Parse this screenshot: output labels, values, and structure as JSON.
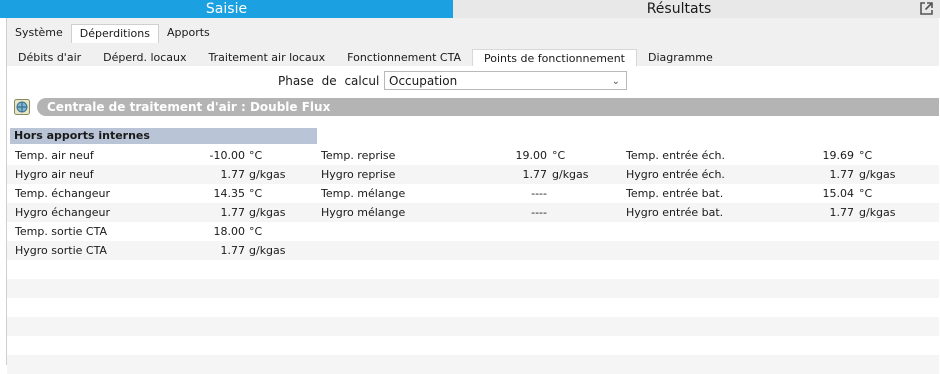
{
  "top_tabs": {
    "saisie": "Saisie",
    "resultats": "Résultats",
    "external_icon": "external-link-icon"
  },
  "tabs1": [
    "Système",
    "Déperditions",
    "Apports"
  ],
  "tabs2": [
    "Débits d'air",
    "Déperd. locaux",
    "Traitement air locaux",
    "Fonctionnement CTA",
    "Points de fonctionnement",
    "Diagramme"
  ],
  "phase": {
    "label": "Phase de calcul :",
    "value": "Occupation"
  },
  "cta": {
    "title": "Centrale de traitement d'air : Double Flux",
    "icon": "cta-icon"
  },
  "section_title": "Hors apports internes",
  "rows": [
    [
      {
        "label": "Temp. air neuf",
        "value": "-10.00",
        "unit": "°C"
      },
      {
        "label": "Temp. reprise",
        "value": "19.00",
        "unit": "°C"
      },
      {
        "label": "Temp. entrée éch.",
        "value": "19.69",
        "unit": "°C"
      }
    ],
    [
      {
        "label": "Hygro air neuf",
        "value": "1.77",
        "unit": "g/kgas"
      },
      {
        "label": "Hygro reprise",
        "value": "1.77",
        "unit": "g/kgas"
      },
      {
        "label": "Hygro entrée éch.",
        "value": "1.77",
        "unit": "g/kgas"
      }
    ],
    [
      {
        "label": "Temp. échangeur",
        "value": "14.35",
        "unit": "°C"
      },
      {
        "label": "Temp. mélange",
        "value": "----",
        "unit": ""
      },
      {
        "label": "Temp. entrée bat.",
        "value": "15.04",
        "unit": "°C"
      }
    ],
    [
      {
        "label": "Hygro échangeur",
        "value": "1.77",
        "unit": "g/kgas"
      },
      {
        "label": "Hygro mélange",
        "value": "----",
        "unit": ""
      },
      {
        "label": "Hygro entrée bat.",
        "value": "1.77",
        "unit": "g/kgas"
      }
    ],
    [
      {
        "label": "Temp. sortie CTA",
        "value": "18.00",
        "unit": "°C"
      }
    ],
    [
      {
        "label": "Hygro sortie CTA",
        "value": "1.77",
        "unit": "g/kgas"
      }
    ],
    [],
    [],
    [],
    [],
    [],
    []
  ]
}
